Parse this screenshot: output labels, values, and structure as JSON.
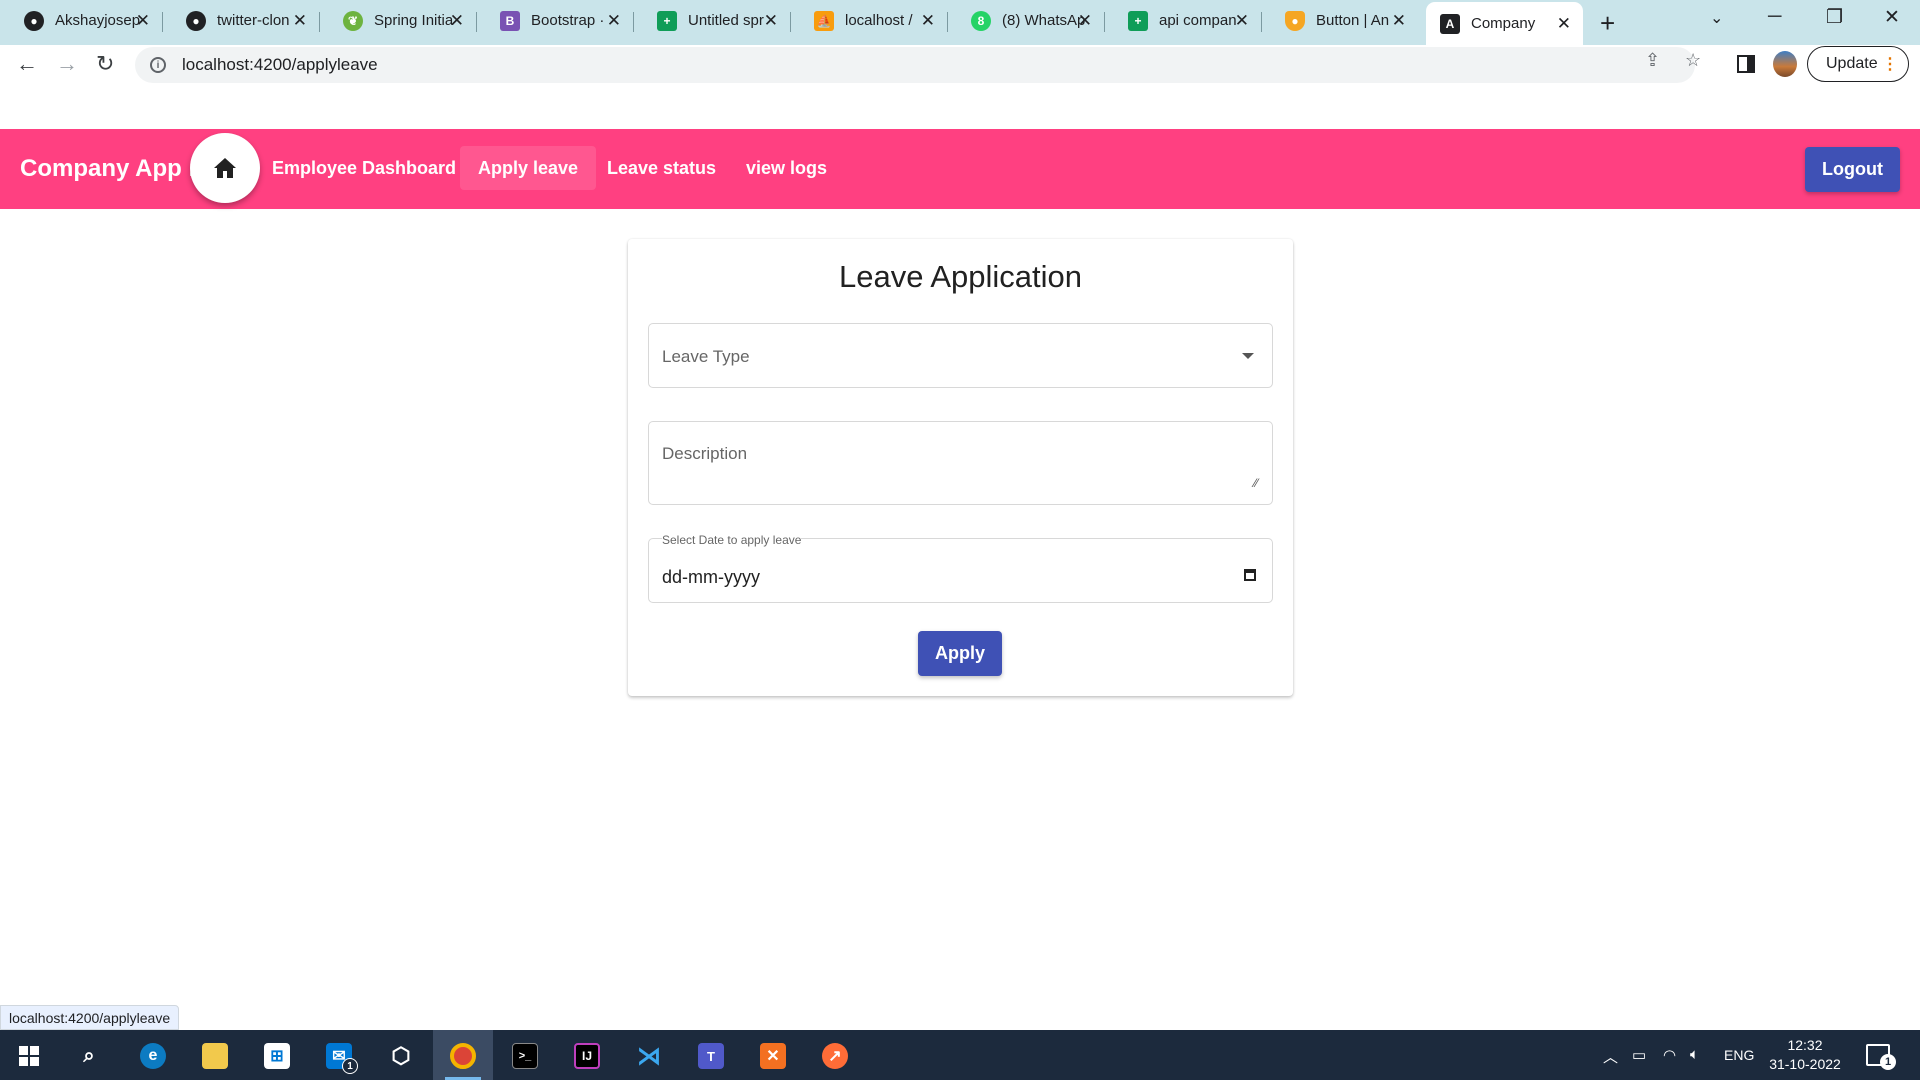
{
  "browser": {
    "tabs": [
      {
        "label": "Akshayjosep",
        "icon": "github-icon",
        "color": "#202124"
      },
      {
        "label": "twitter-clon",
        "icon": "github-icon",
        "color": "#202124"
      },
      {
        "label": "Spring Initia",
        "icon": "spring-icon",
        "color": "#6db33f"
      },
      {
        "label": "Bootstrap ·",
        "icon": "bootstrap-icon",
        "color": "#7952b3"
      },
      {
        "label": "Untitled spr",
        "icon": "sheets-icon",
        "color": "#0f9d58"
      },
      {
        "label": "localhost /",
        "icon": "phpmyadmin-icon",
        "color": "#f89c0e"
      },
      {
        "label": "(8) WhatsAp",
        "icon": "whatsapp-icon",
        "color": "#25d366"
      },
      {
        "label": "api compan",
        "icon": "sheets-icon",
        "color": "#0f9d58"
      },
      {
        "label": "Button | An",
        "icon": "shield-icon",
        "color": "#f5a623"
      },
      {
        "label": "Company",
        "icon": "angular-icon",
        "color": "#202124"
      }
    ],
    "url": "localhost:4200/applyleave",
    "update_label": "Update"
  },
  "app": {
    "brand": "Company App .",
    "nav": {
      "employee_dashboard": "Employee Dashboard",
      "apply_leave": "Apply leave",
      "leave_status": "Leave status",
      "view_logs": "view logs"
    },
    "logout": "Logout"
  },
  "form": {
    "title": "Leave Application",
    "leave_type_placeholder": "Leave Type",
    "description_placeholder": "Description",
    "date_label": "Select Date to apply leave",
    "date_placeholder": "dd-mm-yyyy",
    "apply": "Apply"
  },
  "status_url": "localhost:4200/applyleave",
  "taskbar": {
    "language": "ENG",
    "time": "12:32",
    "date": "31-10-2022",
    "notifications": "1",
    "mail_badge": "1"
  },
  "colors": {
    "appbar": "#ff4081",
    "primary_button": "#3f51b5"
  }
}
